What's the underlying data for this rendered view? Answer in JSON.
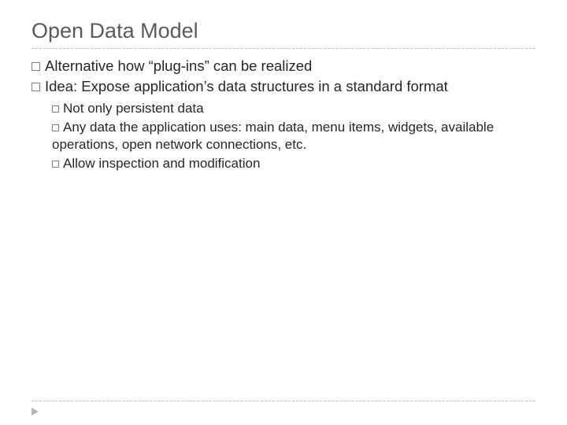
{
  "title": "Open Data Model",
  "bullets": [
    {
      "lead": "Alternative",
      "rest": " how “plug-ins” can be realized"
    },
    {
      "lead": "Idea:",
      "rest": " Expose application’s data structures in a standard format"
    }
  ],
  "sub_bullets": [
    {
      "lead": "Not",
      "rest": " only persistent data"
    },
    {
      "lead": "Any",
      "rest": " data the application uses: main data, menu items, widgets, available operations, open network connections, etc."
    },
    {
      "lead": "Allow",
      "rest": " inspection and modification"
    }
  ]
}
